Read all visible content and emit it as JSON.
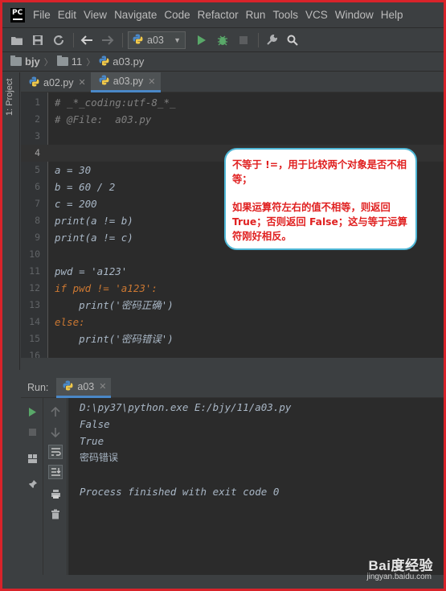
{
  "menu": {
    "logo": "PC",
    "items": [
      "File",
      "Edit",
      "View",
      "Navigate",
      "Code",
      "Refactor",
      "Run",
      "Tools",
      "VCS",
      "Window",
      "Help"
    ]
  },
  "toolbar": {
    "run_config": "a03"
  },
  "navbar": {
    "crumbs": [
      "bjy",
      "11",
      "a03.py"
    ]
  },
  "sidebar": {
    "label": "1: Project"
  },
  "tabs": [
    {
      "label": "a02.py",
      "active": false
    },
    {
      "label": "a03.py",
      "active": true
    }
  ],
  "editor": {
    "line_numbers": [
      "1",
      "2",
      "3",
      "4",
      "5",
      "6",
      "7",
      "8",
      "9",
      "10",
      "11",
      "12",
      "13",
      "14",
      "15",
      "16"
    ],
    "lines": [
      "# _*_coding:utf-8_*_",
      "# @File:  a03.py",
      "",
      "",
      "a = 30",
      "b = 60 / 2",
      "c = 200",
      "print(a != b)",
      "print(a != c)",
      "",
      "pwd = 'a123'",
      "if pwd != 'a123':",
      "    print('密码正确')",
      "else:",
      "    print('密码错误')",
      ""
    ]
  },
  "callout": {
    "para1": "不等于 !=，用于比较两个对象是否不相等；",
    "para2": "如果运算符左右的值不相等，则返回 True；否则返回 False；这与等于运算符刚好相反。"
  },
  "run": {
    "label": "Run:",
    "tab": "a03",
    "output": [
      "D:\\py37\\python.exe E:/bjy/11/a03.py",
      "False",
      "True",
      "密码错误",
      "",
      "Process finished with exit code 0"
    ]
  },
  "watermark": {
    "brand": "Bai度经验",
    "url": "jingyan.baidu.com"
  },
  "colors": {
    "frame_border": "#d9232a",
    "ide_bg": "#3c3f41",
    "editor_bg": "#2b2b2b",
    "callout_border": "#4fb7d6",
    "callout_text": "#e02020"
  }
}
